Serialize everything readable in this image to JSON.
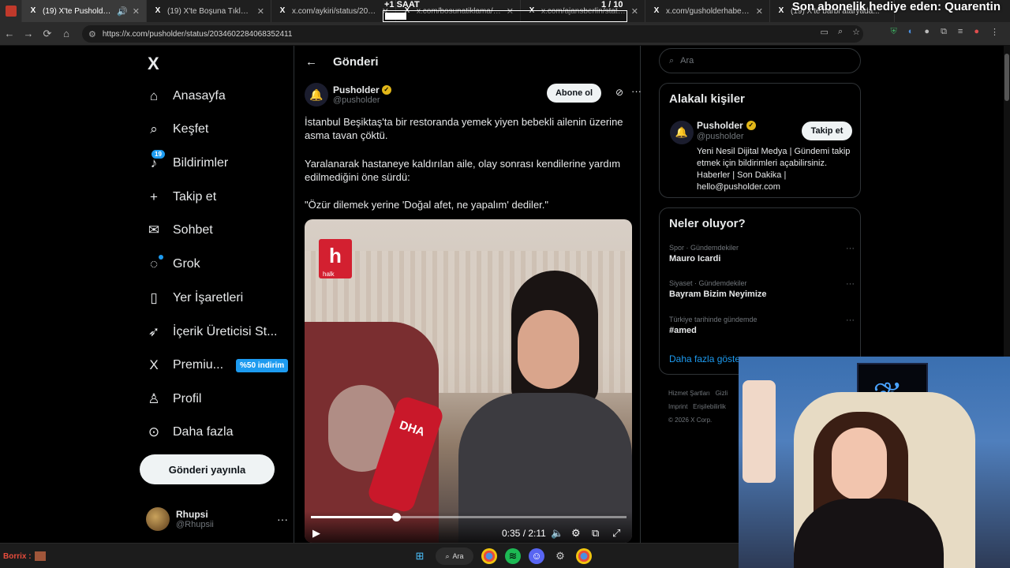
{
  "browser": {
    "tabs": [
      {
        "label": "(19) X'te Pusholder: \"İstanbu",
        "active": true
      },
      {
        "label": "(19) X'te Boşuna Tıklama: \"İzmi"
      },
      {
        "label": "x.com/aykiri/status/20346072"
      },
      {
        "label": "x.com/bosunatiklama/status/2"
      },
      {
        "label": "x.com/ajansberlin/status/20"
      },
      {
        "label": "x.com/gusholderhaber/status/2"
      },
      {
        "label": "(19) X'te barbi ataryada..."
      }
    ],
    "url": "https://x.com/pusholder/status/2034602284068352411"
  },
  "stream_overlay": {
    "timer_label": "+1 SAAT",
    "counter": "1  / 10",
    "progress": 0.09,
    "sub_alert": "Son abonelik hediye eden: Quarentin"
  },
  "sidebar": {
    "logo": "X",
    "items": [
      {
        "label": "Anasayfa",
        "icon": "home-icon",
        "glyph": "⌂"
      },
      {
        "label": "Keşfet",
        "icon": "search-icon",
        "glyph": "⌕"
      },
      {
        "label": "Bildirimler",
        "icon": "bell-icon",
        "glyph": "🔔",
        "badge": "19"
      },
      {
        "label": "Takip et",
        "icon": "follow-icon",
        "glyph": "👤"
      },
      {
        "label": "Sohbet",
        "icon": "mail-icon",
        "glyph": "✉"
      },
      {
        "label": "Grok",
        "icon": "grok-icon",
        "glyph": "◌"
      },
      {
        "label": "Yer İşaretleri",
        "icon": "bookmark-icon",
        "glyph": "🔖"
      },
      {
        "label": "İçerik Üreticisi St...",
        "icon": "rocket-icon",
        "glyph": "🚀"
      },
      {
        "label": "Premiu...",
        "icon": "x-premium-icon",
        "glyph": "X",
        "badge_text": "%50 indirim"
      },
      {
        "label": "Profil",
        "icon": "profile-icon",
        "glyph": "👤"
      },
      {
        "label": "Daha fazla",
        "icon": "more-circle-icon",
        "glyph": "⋯"
      }
    ],
    "post_button": "Gönderi yayınla",
    "account": {
      "name": "Rhupsi",
      "handle": "@Rhupsii"
    }
  },
  "main": {
    "header_title": "Gönderi",
    "author": {
      "name": "Pusholder",
      "handle": "@pusholder"
    },
    "subscribe_button": "Abone ol",
    "paragraphs": [
      "İstanbul Beşiktaş'ta bir restoranda yemek yiyen bebekli ailenin üzerine asma tavan çöktü.",
      "Yaralanarak hastaneye kaldırılan aile, olay sonrası kendilerine yardım edilmediğini öne sürdü:",
      "\"Özür dilemek yerine 'Doğal afet, ne yapalım' dediler.\""
    ],
    "video": {
      "channel_logo": "h",
      "channel_sub": "halk",
      "mic_label": "DHA",
      "time": "0:35 / 2:11",
      "progress": 0.27
    }
  },
  "right": {
    "search_placeholder": "Ara",
    "related": {
      "title": "Alakalı kişiler",
      "name": "Pusholder",
      "handle": "@pusholder",
      "follow_button": "Takip et",
      "bio": "Yeni Nesil Dijital Medya | Gündemi takip etmek için bildirimleri açabilirsiniz. Haberler | Son Dakika | hello@pusholder.com"
    },
    "trends": {
      "title": "Neler oluyor?",
      "items": [
        {
          "category": "Spor · Gündemdekiler",
          "name": "Mauro Icardi"
        },
        {
          "category": "Siyaset · Gündemdekiler",
          "name": "Bayram Bizim Neyimize"
        },
        {
          "category": "Türkiye tarihinde gündemde",
          "name": "#amed"
        }
      ],
      "show_more": "Daha fazla göster"
    },
    "footer": [
      "Hizmet Şartları",
      "Gizli",
      "Imprint",
      "Erişilebilirlik",
      "© 2026 X Corp."
    ]
  },
  "taskbar": {
    "chat_user": "Borrix :",
    "search_label": "Ara"
  }
}
